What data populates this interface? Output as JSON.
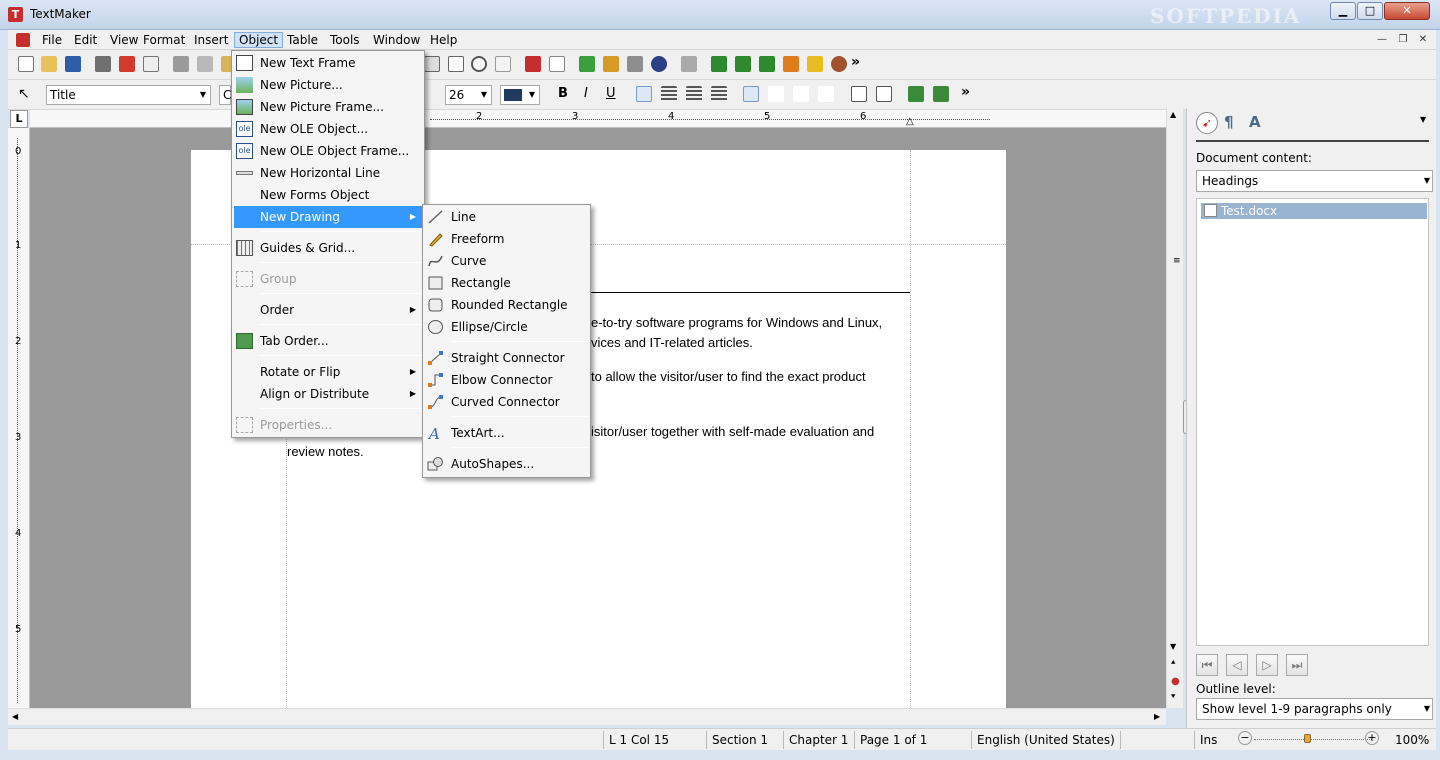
{
  "window": {
    "title": "TextMaker",
    "watermark": "SOFTPEDIA"
  },
  "menubar": [
    "File",
    "Edit",
    "View",
    "Format",
    "Insert",
    "Object",
    "Table",
    "Tools",
    "Window",
    "Help"
  ],
  "format_toolbar": {
    "style": "Title",
    "font": "C",
    "size": "26"
  },
  "ruler": {
    "h_numbers": [
      "2",
      "3",
      "4",
      "5",
      "6"
    ],
    "v_numbers": [
      "0",
      "1",
      "2",
      "3",
      "4",
      "5"
    ]
  },
  "document": {
    "line1": "e-to-try software programs for Windows and Linux,",
    "line2": "vices and IT-related articles.",
    "line3": "to allow the visitor/user to find the exact product",
    "line4": "isitor/user together with self-made evaluation and",
    "line5": "review notes."
  },
  "object_menu": {
    "items": [
      {
        "label": "New Text Frame",
        "icon": "text-frame-icon"
      },
      {
        "label": "New Picture...",
        "icon": "picture-icon"
      },
      {
        "label": "New Picture Frame...",
        "icon": "picture-frame-icon"
      },
      {
        "label": "New OLE Object...",
        "icon": "ole-object-icon"
      },
      {
        "label": "New OLE Object Frame...",
        "icon": "ole-frame-icon"
      },
      {
        "label": "New Horizontal Line",
        "icon": "horizontal-line-icon"
      },
      {
        "label": "New Forms Object",
        "icon": ""
      },
      {
        "label": "New Drawing",
        "icon": ""
      },
      {
        "label": "Guides & Grid...",
        "icon": "grid-icon"
      },
      {
        "label": "Group",
        "icon": "group-icon"
      },
      {
        "label": "Order",
        "icon": ""
      },
      {
        "label": "Tab Order...",
        "icon": "tab-order-icon"
      },
      {
        "label": "Rotate or Flip",
        "icon": ""
      },
      {
        "label": "Align or Distribute",
        "icon": ""
      },
      {
        "label": "Properties...",
        "icon": "properties-icon"
      }
    ]
  },
  "drawing_menu": {
    "items": [
      {
        "label": "Line"
      },
      {
        "label": "Freeform"
      },
      {
        "label": "Curve"
      },
      {
        "label": "Rectangle"
      },
      {
        "label": "Rounded Rectangle"
      },
      {
        "label": "Ellipse/Circle"
      },
      {
        "label": "Straight Connector"
      },
      {
        "label": "Elbow Connector"
      },
      {
        "label": "Curved Connector"
      },
      {
        "label": "TextArt..."
      },
      {
        "label": "AutoShapes..."
      }
    ]
  },
  "sidebar": {
    "doc_content_label": "Document content:",
    "doc_content_value": "Headings",
    "tree_item": "Test.docx",
    "outline_label": "Outline level:",
    "outline_value": "Show level 1-9 paragraphs only"
  },
  "statusbar": {
    "position": "L 1 Col 15",
    "section": "Section 1",
    "chapter": "Chapter 1",
    "page": "Page 1 of 1",
    "language": "English (United States)",
    "mode": "Ins",
    "zoom": "100%"
  }
}
